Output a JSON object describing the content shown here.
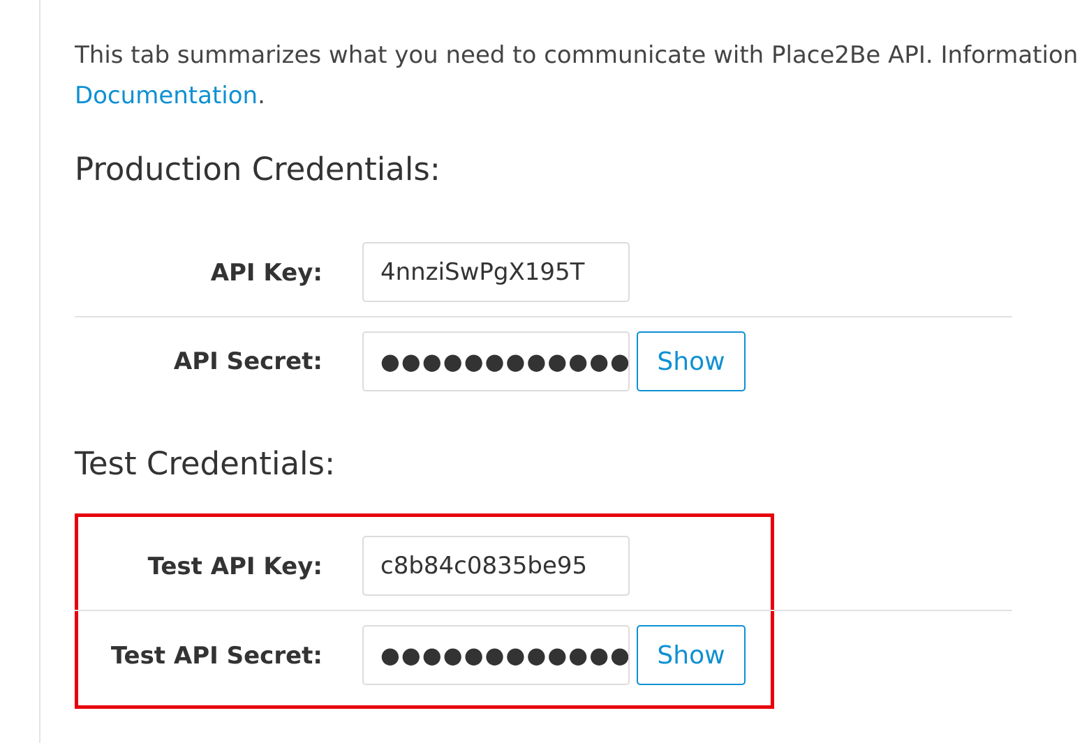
{
  "intro": {
    "text": "This tab summarizes what you need to communicate with Place2Be API. Information",
    "link_label": "Documentation",
    "after_link": "."
  },
  "production": {
    "title": "Production Credentials:",
    "api_key_label": "API Key:",
    "api_key_value": "4nnziSwPgX195T",
    "api_secret_label": "API Secret:",
    "api_secret_value": "●●●●●●●●●●●●●●",
    "show_label": "Show"
  },
  "test": {
    "title": "Test Credentials:",
    "api_key_label": "Test API Key:",
    "api_key_value": "c8b84c0835be95",
    "api_secret_label": "Test API Secret:",
    "api_secret_value": "●●●●●●●●●●●●●●",
    "show_label": "Show"
  },
  "colors": {
    "link": "#0e90d2",
    "highlight": "#e8000b"
  }
}
